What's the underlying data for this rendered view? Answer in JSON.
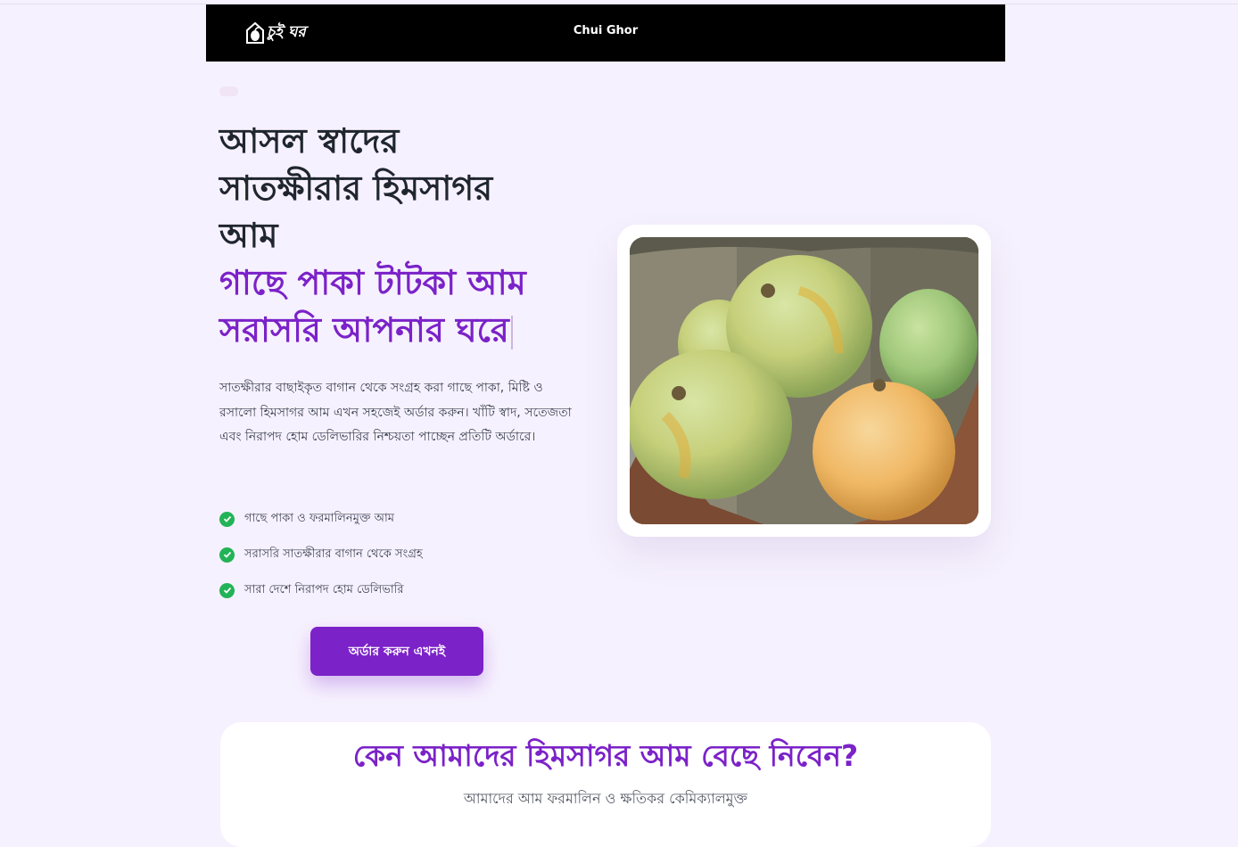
{
  "header": {
    "logo_text": "চুই ঘর",
    "site_title": "Chui Ghor"
  },
  "hero": {
    "title_lines": [
      "আসল স্বাদের",
      "সাতক্ষীরার হিমসাগর",
      "আম"
    ],
    "accent_lines": [
      "গাছে পাকা টাটকা আম",
      "সরাসরি আপনার ঘরে"
    ],
    "description": "সাতক্ষীরার বাছাইকৃত বাগান থেকে সংগ্রহ করা গাছে পাকা, মিষ্টি ও রসালো হিমসাগর আম এখন সহজেই অর্ডার করুন। খাঁটি স্বাদ, সতেজতা এবং নিরাপদ হোম ডেলিভারির নিশ্চয়তা পাচ্ছেন প্রতিটি অর্ডারে।",
    "features": [
      "গাছে পাকা ও ফরমালিনমুক্ত আম",
      "সরাসরি সাতক্ষীরার বাগান থেকে সংগ্রহ",
      "সারা দেশে নিরাপদ হোম ডেলিভারি"
    ],
    "cta_label": "অর্ডার করুন এখনই"
  },
  "why": {
    "title": "কেন আমাদের হিমসাগর আম বেছে নিবেন?",
    "subtitle": "আমাদের আম ফরমালিন ও ক্ষতিকর কেমিক্যালমুক্ত"
  },
  "colors": {
    "accent": "#7b22c8",
    "check": "#22b357",
    "background": "#f6f1fe",
    "header_bg": "#000000"
  },
  "icons": {
    "logo": "mango-house-logo-icon",
    "feature": "check-circle-icon"
  }
}
